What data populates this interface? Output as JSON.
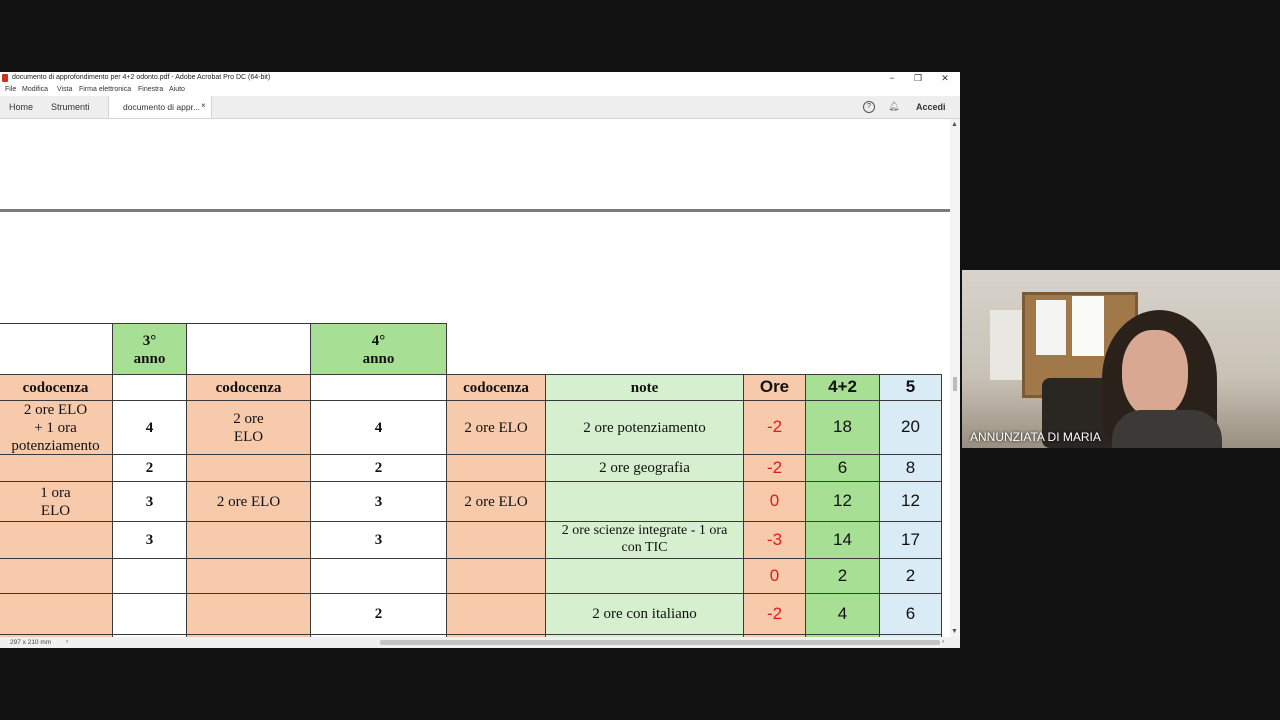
{
  "window": {
    "title": "documento di approfondimento per  4+2 odonto.pdf - Adobe Acrobat Pro DC (64-bit)",
    "controls": {
      "minimize": "−",
      "maximize": "❐",
      "close": "✕"
    }
  },
  "menu": {
    "items": [
      "File",
      "Modifica",
      "Vista",
      "Firma elettronica",
      "Finestra",
      "Aiuto"
    ]
  },
  "tabs": {
    "home": "Home",
    "tools": "Strumenti",
    "document": "documento di appr...",
    "document_close": "×",
    "help": "?",
    "login": "Accedi"
  },
  "status": {
    "page_size": "297 x 210 mm",
    "left_arrow": "‹",
    "right_arrow": "›"
  },
  "table": {
    "year3": [
      "3°",
      "anno"
    ],
    "year4": [
      "4°",
      "anno"
    ],
    "headers": {
      "codocenza": "codocenza",
      "note": "note",
      "ore": "Ore",
      "h42": "4+2",
      "h5": "5"
    },
    "rows": [
      {
        "cod1": [
          "2 ore ELO",
          "+ 1 ora",
          "potenziamento"
        ],
        "y3": "4",
        "cod2": [
          "2 ore",
          "ELO"
        ],
        "y4": "4",
        "cod3": "2 ore ELO",
        "note": "2 ore potenziamento",
        "ore": "-2",
        "v42": "18",
        "v5": "20"
      },
      {
        "cod1": [],
        "y3": "2",
        "cod2": [],
        "y4": "2",
        "cod3": "",
        "note": "2 ore geografia",
        "ore": "-2",
        "v42": "6",
        "v5": "8"
      },
      {
        "cod1": [
          "1 ora",
          "ELO"
        ],
        "y3": "3",
        "cod2": [
          "2 ore ELO"
        ],
        "y4": "3",
        "cod3": "2 ore ELO",
        "note": "",
        "ore": "0",
        "v42": "12",
        "v5": "12"
      },
      {
        "cod1": [],
        "y3": "3",
        "cod2": [],
        "y4": "3",
        "cod3": "",
        "note": "2 ore scienze integrate - 1 ora con TIC",
        "ore": "-3",
        "v42": "14",
        "v5": "17"
      },
      {
        "cod1": [],
        "y3": "",
        "cod2": [],
        "y4": "",
        "cod3": "",
        "note": "",
        "ore": "0",
        "v42": "2",
        "v5": "2"
      },
      {
        "cod1": [],
        "y3": "",
        "cod2": [],
        "y4": "2",
        "cod3": "",
        "note": "2 ore con italiano",
        "ore": "-2",
        "v42": "4",
        "v5": "6"
      }
    ]
  },
  "video": {
    "participant_name": "ANNUNZIATA DI MARIA"
  },
  "colors": {
    "pink": "#f7caac",
    "light_green": "#d5efcf",
    "green": "#a7df94",
    "light_blue": "#d9ebf5",
    "negative_red": "#e21b1b"
  }
}
